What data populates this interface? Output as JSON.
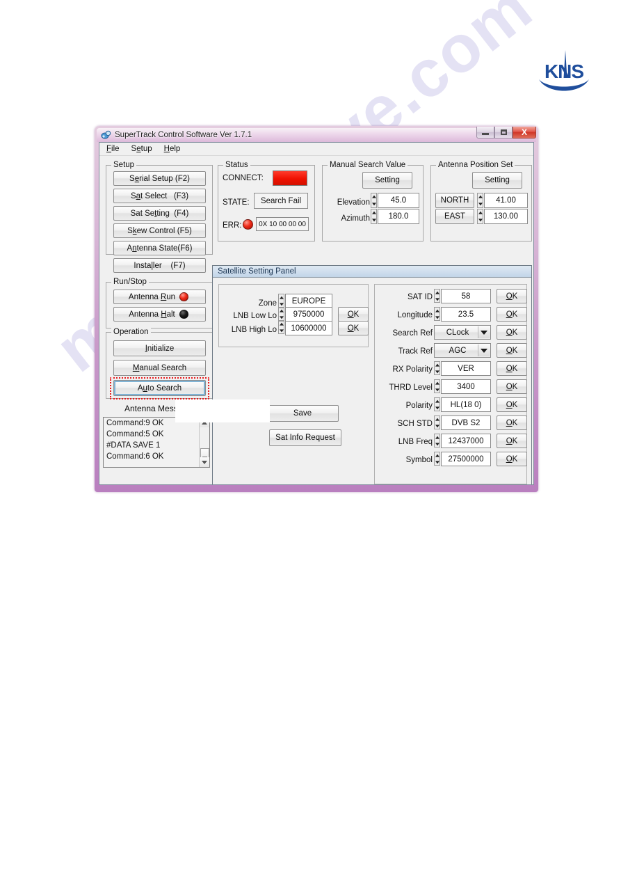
{
  "brand": {
    "logo_text": "KNS",
    "logo_color": "#1f4e9c"
  },
  "watermark": {
    "text": "manualshive.com",
    "color": "#786ec8"
  },
  "window": {
    "title": "SuperTrack Control Software Ver 1.7.1",
    "icon": "app-satellite-icon",
    "controls": {
      "minimize": "minimize-icon",
      "maximize": "maximize-icon",
      "close": "X"
    }
  },
  "menubar": {
    "items": [
      "File",
      "Setup",
      "Help"
    ]
  },
  "setup_group": {
    "title": "Setup",
    "buttons": [
      {
        "label": "Serial Setup (F2)",
        "name": "serial-setup-button"
      },
      {
        "label": "Sat Select   (F3)",
        "name": "sat-select-button"
      },
      {
        "label": "Sat Setting  (F4)",
        "name": "sat-setting-button"
      },
      {
        "label": "Skew Control (F5)",
        "name": "skew-control-button"
      },
      {
        "label": "Antenna State(F6)",
        "name": "antenna-state-button"
      },
      {
        "label": "Installer    (F7)",
        "name": "installer-button"
      }
    ]
  },
  "runstop_group": {
    "title": "Run/Stop",
    "run_label": "Antenna Run",
    "run_led": "red",
    "halt_label": "Antenna Halt",
    "halt_led": "black"
  },
  "operation_group": {
    "title": "Operation",
    "initialize_label": "Initialize",
    "manual_search_label": "Manual Search",
    "auto_search_label": "Auto Search",
    "auto_search_highlight_color": "#e8191b"
  },
  "messages": {
    "title": "Antenna Message",
    "lines": [
      "Command:9 OK",
      "Command:5 OK",
      "#DATA SAVE 1",
      "Command:6 OK"
    ]
  },
  "status_group": {
    "title": "Status",
    "connect_label": "CONNECT:",
    "connect_color": "#ef1100",
    "state_label": "STATE:",
    "state_value": "Search Fail",
    "err_label": "ERR:",
    "err_led": "red",
    "err_value": "0X 10 00 00 00"
  },
  "manual_search_group": {
    "title": "Manual Search Value",
    "setting_label": "Setting",
    "rows": [
      {
        "label": "Elevation",
        "value": "45.0"
      },
      {
        "label": "Azimuth",
        "value": "180.0"
      }
    ]
  },
  "antenna_position_group": {
    "title": "Antenna Position Set",
    "setting_label": "Setting",
    "rows": [
      {
        "dir": "NORTH",
        "value": "41.00"
      },
      {
        "dir": "EAST",
        "value": "130.00"
      }
    ]
  },
  "satellite_panel": {
    "title": "Satellite Setting Panel",
    "left": {
      "rows": [
        {
          "label": "Zone",
          "value": "EUROPE",
          "ok": null
        },
        {
          "label": "LNB Low Lo",
          "value": "9750000",
          "ok": "OK"
        },
        {
          "label": "LNB High Lo",
          "value": "10600000",
          "ok": "OK"
        }
      ],
      "save_label": "Save",
      "sat_info_label": "Sat Info Request"
    },
    "right": {
      "ok_label": "OK",
      "rows": [
        {
          "label": "SAT ID",
          "value": "58",
          "type": "spin"
        },
        {
          "label": "Longitude",
          "value": "23.5",
          "type": "spin"
        },
        {
          "label": "Search Ref",
          "value": "CLock",
          "type": "combo"
        },
        {
          "label": "Track Ref",
          "value": "AGC",
          "type": "combo"
        },
        {
          "label": "RX Polarity",
          "value": "VER",
          "type": "spin"
        },
        {
          "label": "THRD Level",
          "value": "3400",
          "type": "spin"
        },
        {
          "label": "Polarity",
          "value": "HL(18 0)",
          "type": "spin"
        },
        {
          "label": "SCH STD",
          "value": "DVB S2",
          "type": "spin"
        },
        {
          "label": "LNB Freq",
          "value": "12437000",
          "type": "spin"
        },
        {
          "label": "Symbol",
          "value": "27500000",
          "type": "spin"
        }
      ]
    }
  }
}
